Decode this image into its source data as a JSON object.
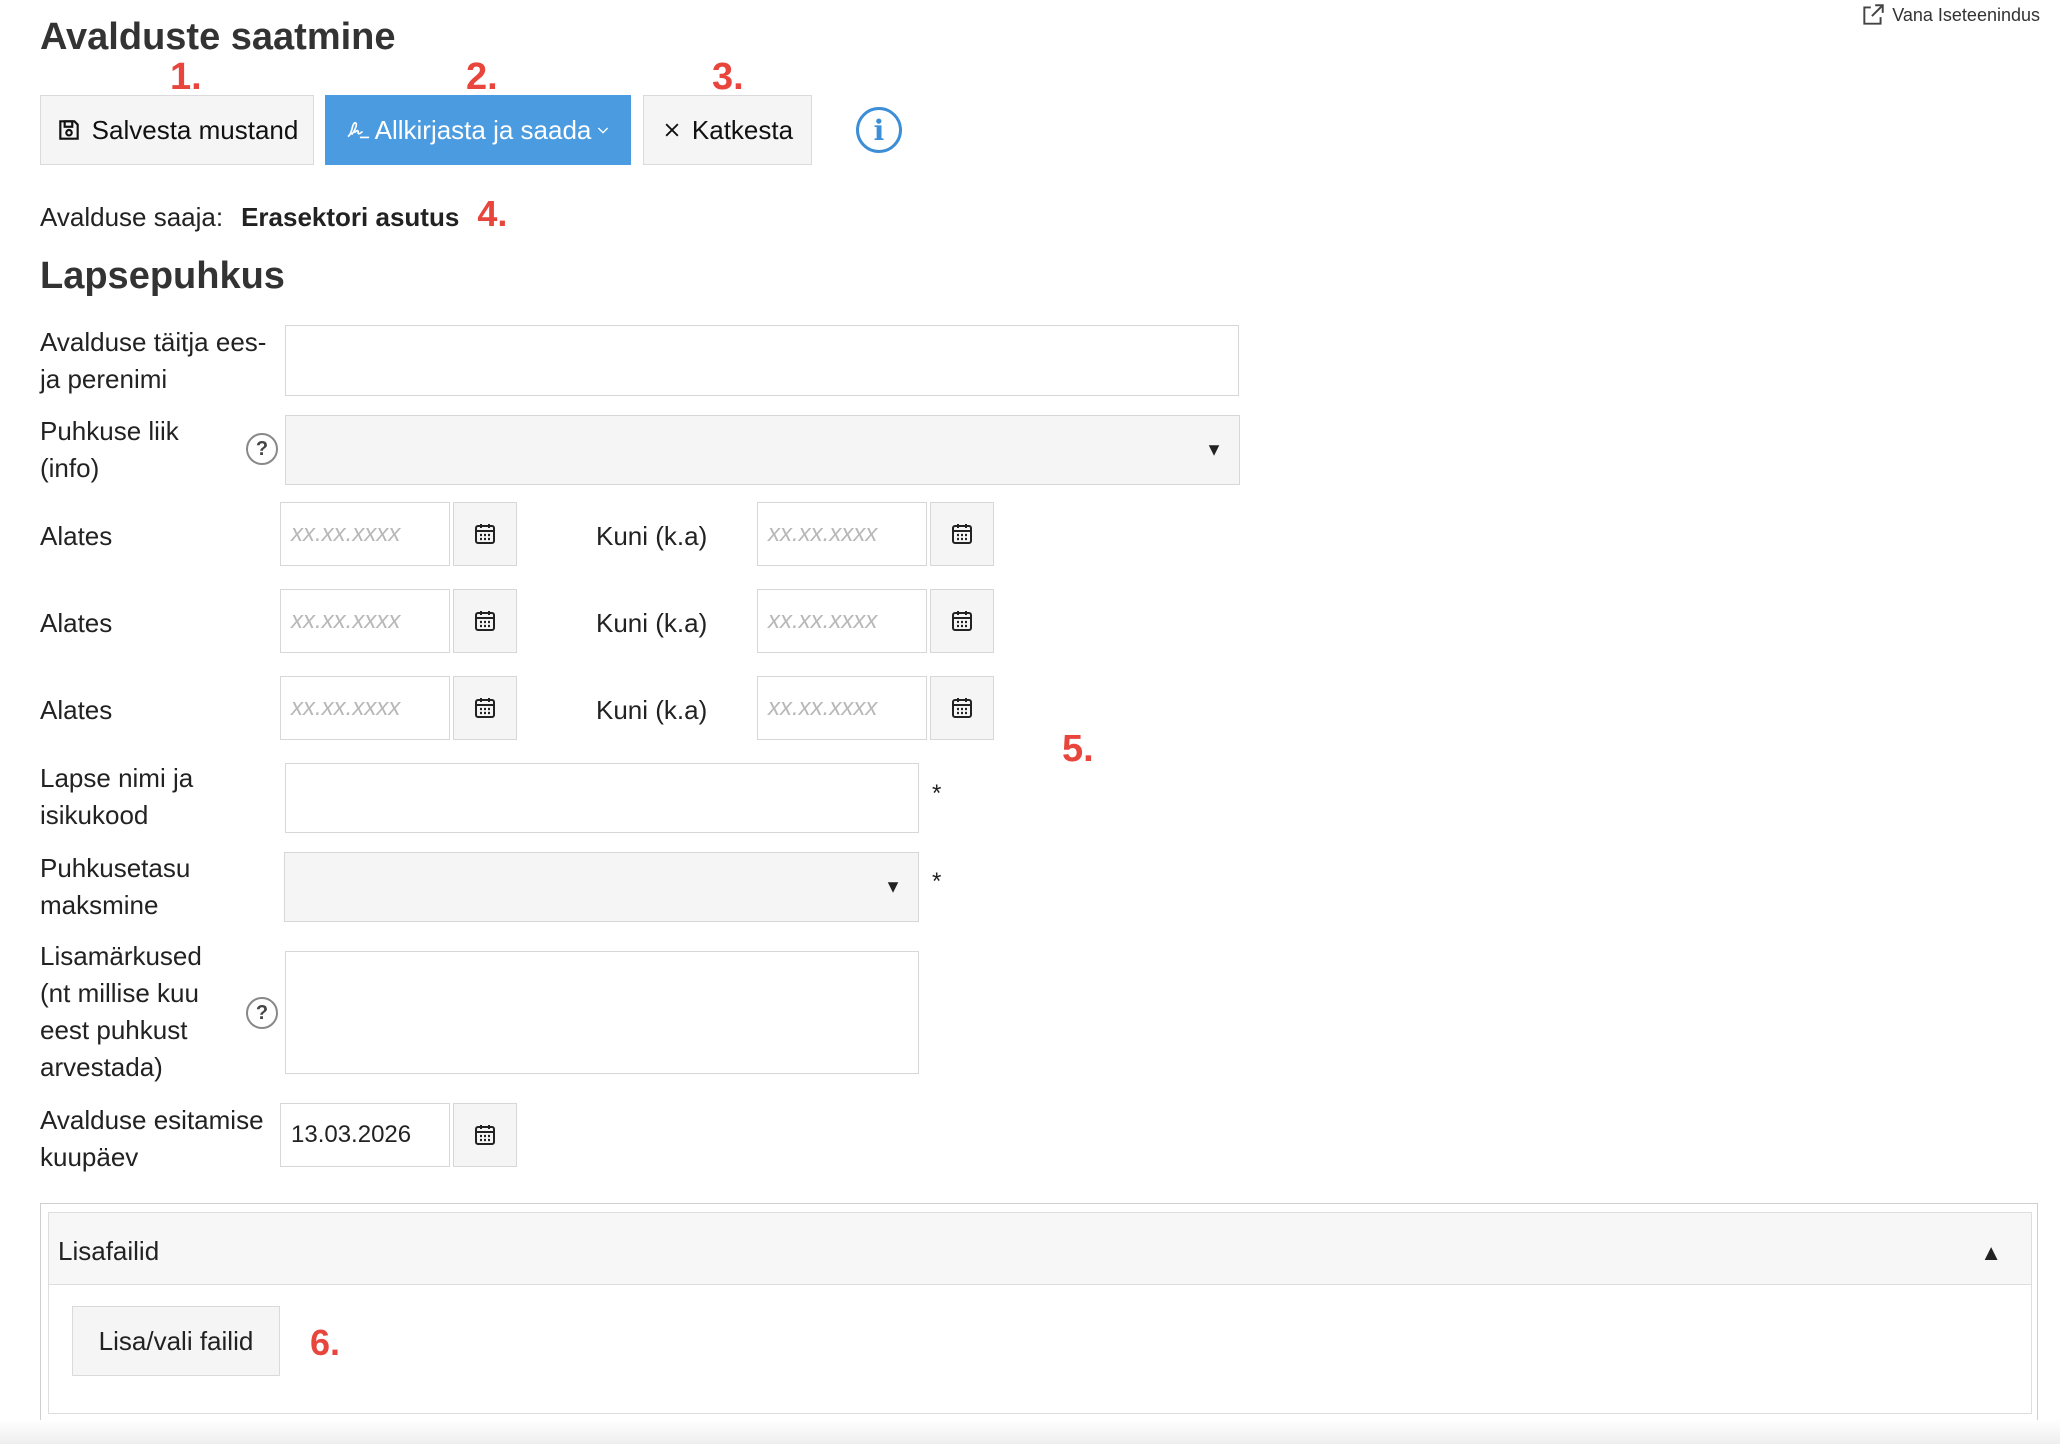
{
  "page": {
    "title": "Avalduste saatmine",
    "old_portal_link": "Vana Iseteenindus"
  },
  "markers": [
    "1.",
    "2.",
    "3.",
    "4.",
    "5.",
    "6."
  ],
  "toolbar": {
    "save_draft": "Salvesta mustand",
    "sign_and_send": "Allkirjasta ja saada",
    "cancel": "Katkesta",
    "info_icon": "i"
  },
  "recipient": {
    "label": "Avalduse saaja:",
    "value": "Erasektori asutus"
  },
  "form": {
    "title": "Lapsepuhkus",
    "applicant_name": {
      "label_line1": "Avalduse täitja ees-",
      "label_line2": "ja perenimi",
      "value": ""
    },
    "leave_type": {
      "label_line1": "Puhkuse liik",
      "label_line2": "(info)",
      "value": "",
      "help": "?"
    },
    "periods": [
      {
        "from_label": "Alates",
        "from_placeholder": "xx.xx.xxxx",
        "to_label": "Kuni (k.a)",
        "to_placeholder": "xx.xx.xxxx"
      },
      {
        "from_label": "Alates",
        "from_placeholder": "xx.xx.xxxx",
        "to_label": "Kuni (k.a)",
        "to_placeholder": "xx.xx.xxxx"
      },
      {
        "from_label": "Alates",
        "from_placeholder": "xx.xx.xxxx",
        "to_label": "Kuni (k.a)",
        "to_placeholder": "xx.xx.xxxx"
      }
    ],
    "child_name": {
      "label_line1": "Lapse nimi ja",
      "label_line2": "isikukood",
      "value": "",
      "required_mark": "*"
    },
    "payment": {
      "label_line1": "Puhkusetasu",
      "label_line2": "maksmine",
      "value": "",
      "required_mark": "*"
    },
    "notes": {
      "label_line1": "Lisamärkused",
      "label_line2": "(nt millise kuu",
      "label_line3": "eest puhkust",
      "label_line4": "arvestada)",
      "value": "",
      "help": "?"
    },
    "submit_date": {
      "label_line1": "Avalduse esitamise",
      "label_line2": "kuupäev",
      "value": "13.03.2026"
    }
  },
  "attachments": {
    "title": "Lisafailid",
    "toggle": "▲",
    "add_button": "Lisa/vali failid"
  },
  "icons": {
    "external_link": "external-link-icon",
    "save": "floppy-disk-icon",
    "signature": "signature-icon",
    "chevron": "chevron-down-icon",
    "close": "close-icon",
    "info": "info-icon",
    "calendar": "calendar-icon",
    "dropdown": "caret-down-icon",
    "help": "help-icon"
  },
  "colors": {
    "primary": "#4a9be0",
    "marker": "#e8453c",
    "info": "#3c8ed6"
  }
}
